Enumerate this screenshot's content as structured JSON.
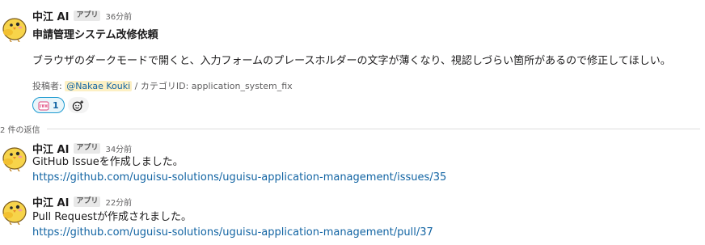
{
  "parent_message": {
    "author": "中江 AI",
    "badge": "アプリ",
    "time": "36分前",
    "title": "申請管理システム改修依頼",
    "body": "ブラウザのダークモードで開くと、入力フォームのプレースホルダーの文字が薄くなり、視認しづらい箇所があるので修正してほしい。",
    "meta_prefix": "投稿者: ",
    "mention": "@Nakae Kouki",
    "meta_suffix": " / カテゴリID: application_system_fix",
    "reaction_count": "1"
  },
  "replies_label": "2 件の返信",
  "replies": [
    {
      "author": "中江 AI",
      "badge": "アプリ",
      "time": "34分前",
      "text": "GitHub Issueを作成しました。",
      "link": "https://github.com/uguisu-solutions/uguisu-application-management/issues/35"
    },
    {
      "author": "中江 AI",
      "badge": "アプリ",
      "time": "22分前",
      "text": "Pull Requestが作成されました。",
      "link": "https://github.com/uguisu-solutions/uguisu-application-management/pull/37"
    }
  ],
  "colors": {
    "link": "#1264a3",
    "reaction_border": "#1d9bd1",
    "mention_bg": "#fdf0c4"
  },
  "icons": {
    "avatar": "bird-avatar-icon",
    "reaction": "looks-good-emoji-icon",
    "add_reaction": "add-reaction-icon"
  }
}
